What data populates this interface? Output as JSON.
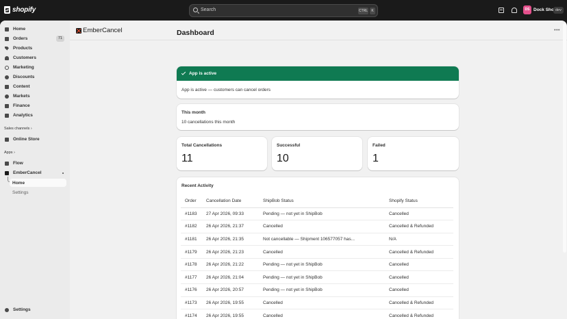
{
  "topbar": {
    "brand": "shopify",
    "search_placeholder": "Search",
    "shortcut_ctrl": "CTRL",
    "shortcut_key": "K",
    "avatar_initials": "DS",
    "store_name": "Dock Shop",
    "env_badge": "dev"
  },
  "sidebar": {
    "items": [
      {
        "label": "Home",
        "icon": "home-icon"
      },
      {
        "label": "Orders",
        "icon": "orders-icon",
        "badge": "71"
      },
      {
        "label": "Products",
        "icon": "tag-icon"
      },
      {
        "label": "Customers",
        "icon": "person-icon"
      },
      {
        "label": "Marketing",
        "icon": "target-icon"
      },
      {
        "label": "Discounts",
        "icon": "discount-icon"
      },
      {
        "label": "Content",
        "icon": "content-icon"
      },
      {
        "label": "Markets",
        "icon": "globe-icon"
      },
      {
        "label": "Finance",
        "icon": "bank-icon"
      },
      {
        "label": "Analytics",
        "icon": "chart-icon"
      }
    ],
    "sales_channels_label": "Sales channels",
    "online_store": "Online Store",
    "apps_label": "Apps",
    "flow": "Flow",
    "app_name": "EmberCancel",
    "app_sub_home": "Home",
    "app_sub_settings": "Settings",
    "settings": "Settings"
  },
  "app_header": {
    "title": "EmberCancel"
  },
  "dashboard": {
    "title": "Dashboard",
    "banner_title": "App is active",
    "banner_body": "App is active — customers can cancel orders",
    "month_title": "This month",
    "month_text": "10 cancellations this month",
    "stats": {
      "total_label": "Total Cancellations",
      "total_value": "11",
      "success_label": "Successful",
      "success_value": "10",
      "failed_label": "Failed",
      "failed_value": "1"
    },
    "activity_title": "Recent Activity",
    "columns": [
      "Order",
      "Cancellation Date",
      "ShipBob Status",
      "Shopify Status"
    ],
    "rows": [
      [
        "#1183",
        "27 Apr 2026, 09:33",
        "Pending — not yet in ShipBob",
        "Cancelled"
      ],
      [
        "#1182",
        "26 Apr 2026, 21:37",
        "Cancelled",
        "Cancelled & Refunded"
      ],
      [
        "#1181",
        "26 Apr 2026, 21:35",
        "Not cancellable — Shipment 106577057 has...",
        "N/A"
      ],
      [
        "#1179",
        "26 Apr 2026, 21:23",
        "Cancelled",
        "Cancelled & Refunded"
      ],
      [
        "#1178",
        "26 Apr 2026, 21:22",
        "Pending — not yet in ShipBob",
        "Cancelled"
      ],
      [
        "#1177",
        "26 Apr 2026, 21:04",
        "Pending — not yet in ShipBob",
        "Cancelled"
      ],
      [
        "#1176",
        "26 Apr 2026, 20:57",
        "Pending — not yet in ShipBob",
        "Cancelled"
      ],
      [
        "#1173",
        "26 Apr 2026, 19:55",
        "Cancelled",
        "Cancelled & Refunded"
      ],
      [
        "#1174",
        "26 Apr 2026, 19:55",
        "Cancelled",
        "Cancelled & Refunded"
      ]
    ]
  },
  "colors": {
    "banner_green": "#0f7a52",
    "topbar_bg": "#1a1a1a",
    "avatar_pink": "#e4508c"
  }
}
